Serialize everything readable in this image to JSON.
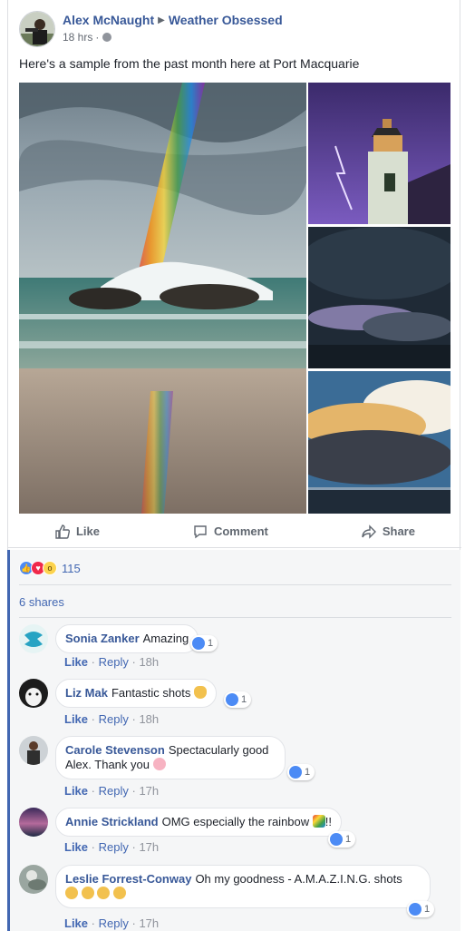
{
  "post": {
    "author": "Alex McNaught",
    "group": "Weather Obsessed",
    "time": "18 hrs",
    "time_separator": "·",
    "text": "Here's a sample from the past month here at Port Macquarie"
  },
  "actions": {
    "like": "Like",
    "comment": "Comment",
    "share": "Share"
  },
  "reactions": {
    "count": "115"
  },
  "shares": "6 shares",
  "comments": [
    {
      "name": "Sonia Zanker",
      "text": "Amazing",
      "like": "Like",
      "reply": "Reply",
      "time": "18h",
      "likes": "1"
    },
    {
      "name": "Liz Mak",
      "text": "Fantastic shots",
      "like": "Like",
      "reply": "Reply",
      "time": "18h",
      "likes": "1"
    },
    {
      "name": "Carole Stevenson",
      "text": "Spectacularly good",
      "text2": "Alex. Thank you",
      "like": "Like",
      "reply": "Reply",
      "time": "17h",
      "likes": "1"
    },
    {
      "name": "Annie Strickland",
      "text": "OMG especially the rainbow",
      "suffix": "!!",
      "like": "Like",
      "reply": "Reply",
      "time": "17h",
      "likes": "1"
    },
    {
      "name": "Leslie Forrest-Conway",
      "text": "Oh my goodness - A.M.A.Z.I.N.G. shots",
      "like": "Like",
      "reply": "Reply",
      "time": "17h",
      "likes": "1"
    }
  ],
  "meta_separator": "·",
  "colors": {
    "link_blue": "#385898",
    "accent_blue": "#4267b2",
    "like_blue": "#4c8bf5",
    "love_red": "#f0284a",
    "wow_yellow": "#fcd34d"
  }
}
